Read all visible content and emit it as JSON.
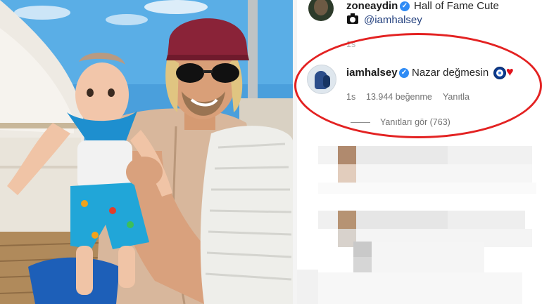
{
  "post_comment": {
    "username": "zoneaydin",
    "text": "Hall of Fame Cute",
    "mention": "@iamhalsey",
    "time": "1s"
  },
  "reply": {
    "username": "iamhalsey",
    "text": "Nazar değmesin",
    "time": "1s",
    "likes": "13.944 beğenme",
    "reply_label": "Yanıtla",
    "view_replies": "Yanıtları gör (763)"
  },
  "colors": {
    "highlight": "#e32222",
    "verified": "#2f8bf5",
    "mention": "#23407e",
    "heart": "#e0121b"
  },
  "icons": [
    "verified-badge-icon",
    "camera-icon",
    "nazar-bead-icon",
    "red-heart-icon"
  ]
}
